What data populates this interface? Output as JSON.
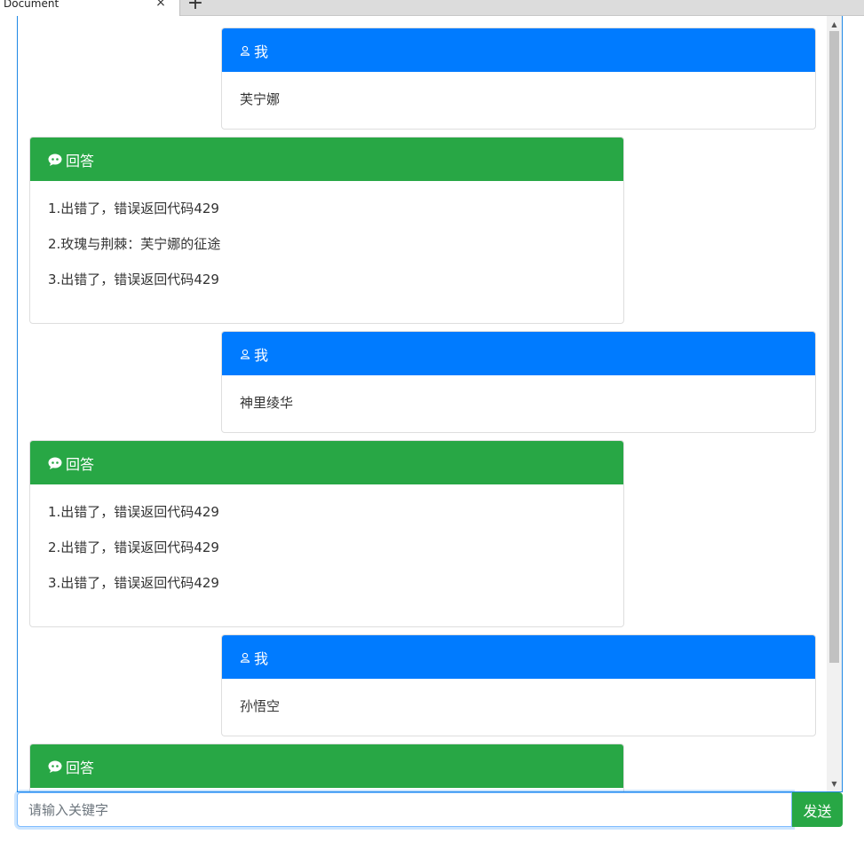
{
  "tab": {
    "title": "Document",
    "close": "×",
    "new": "+"
  },
  "user_label": "我",
  "bot_label": "回答",
  "messages": [
    {
      "role": "user",
      "text": "芙宁娜"
    },
    {
      "role": "bot",
      "lines": [
        "1.出错了，错误返回代码429",
        "2.玫瑰与荆棘：芙宁娜的征途",
        "3.出错了，错误返回代码429"
      ]
    },
    {
      "role": "user",
      "text": "神里绫华"
    },
    {
      "role": "bot",
      "lines": [
        "1.出错了，错误返回代码429",
        "2.出错了，错误返回代码429",
        "3.出错了，错误返回代码429"
      ]
    },
    {
      "role": "user",
      "text": "孙悟空"
    },
    {
      "role": "bot",
      "lines": []
    }
  ],
  "input": {
    "placeholder": "请输入关键字",
    "value": ""
  },
  "send_label": "发送",
  "colors": {
    "user": "#007bff",
    "bot": "#28a745"
  },
  "icons": {
    "user": "user-icon",
    "bot": "chat-bubble-icon"
  }
}
